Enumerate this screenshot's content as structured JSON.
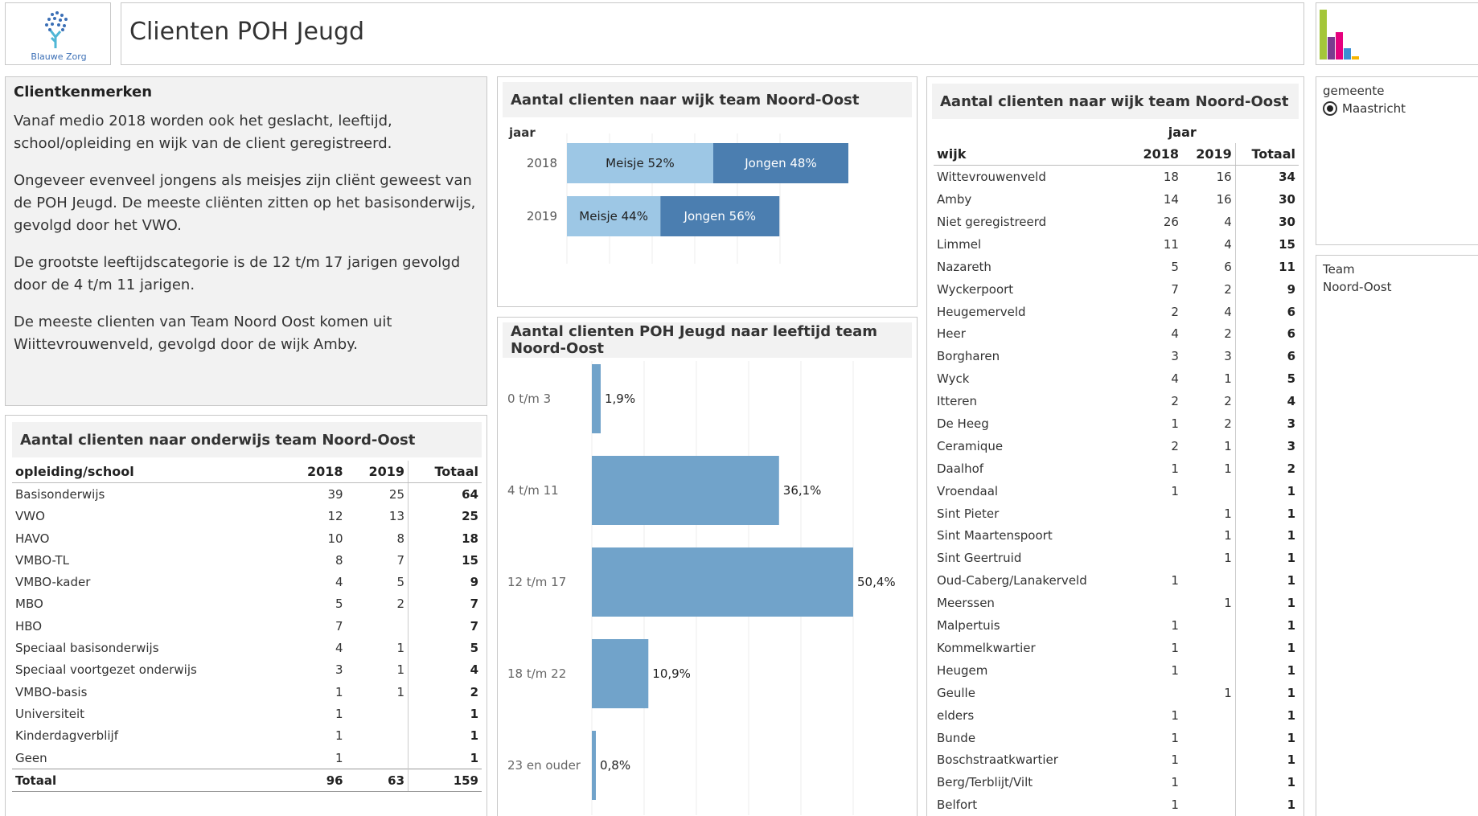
{
  "header": {
    "logo_text": "Blauwe Zorg",
    "title": "Clienten POH Jeugd"
  },
  "colors": {
    "bar_light": "#9dc7e5",
    "bar_dark": "#4b7eb0",
    "bar_age": "#71a3ca",
    "panel_bg": "#f2f2f2"
  },
  "text_panel": {
    "heading": "Clientkenmerken",
    "paragraphs": [
      "Vanaf medio 2018 worden ook het geslacht, leeftijd, school/opleiding en wijk van de client geregistreerd.",
      "Ongeveer evenveel jongens als meisjes zijn cliënt geweest van de POH Jeugd.  De meeste cliënten zitten op het basisonderwijs, gevolgd door het VWO.",
      "De grootste leeftijdscategorie is de 12 t/m 17 jarigen gevolgd door de 4 t/m 11 jarigen.",
      "De meeste clienten van Team Noord Oost komen uit Wiittevrouwenveld, gevolgd door de wijk Amby."
    ]
  },
  "onderwijs": {
    "title": "Aantal clienten naar onderwijs team Noord-Oost",
    "columns": [
      "opleiding/school",
      "2018",
      "2019",
      "Totaal"
    ],
    "rows": [
      [
        "Basisonderwijs",
        "39",
        "25",
        "64"
      ],
      [
        "VWO",
        "12",
        "13",
        "25"
      ],
      [
        "HAVO",
        "10",
        "8",
        "18"
      ],
      [
        "VMBO-TL",
        "8",
        "7",
        "15"
      ],
      [
        "VMBO-kader",
        "4",
        "5",
        "9"
      ],
      [
        "MBO",
        "5",
        "2",
        "7"
      ],
      [
        "HBO",
        "7",
        "",
        "7"
      ],
      [
        "Speciaal basisonderwijs",
        "4",
        "1",
        "5"
      ],
      [
        "Speciaal voortgezet onderwijs",
        "3",
        "1",
        "4"
      ],
      [
        "VMBO-basis",
        "1",
        "1",
        "2"
      ],
      [
        "Universiteit",
        "1",
        "",
        "1"
      ],
      [
        "Kinderdagverblijf",
        "1",
        "",
        "1"
      ],
      [
        "Geen",
        "1",
        "",
        "1"
      ]
    ],
    "total": [
      "Totaal",
      "96",
      "63",
      "159"
    ]
  },
  "geslacht": {
    "title": "Aantal clienten naar wijk team Noord-Oost",
    "axis_label": "jaar",
    "rows": [
      {
        "year": "2018",
        "meisje": 52,
        "jongen": 48,
        "meisje_label": "Meisje 52%",
        "jongen_label": "Jongen 48%"
      },
      {
        "year": "2019",
        "meisje": 44,
        "jongen": 56,
        "meisje_label": "Meisje 44%",
        "jongen_label": "Jongen 56%"
      }
    ]
  },
  "leeftijd": {
    "title": "Aantal clienten POH Jeugd naar leeftijd team Noord-Oost",
    "categories": [
      "0 t/m 3",
      "4 t/m 11",
      "12 t/m 17",
      "18 t/m 22",
      "23 en ouder"
    ],
    "values": [
      1.9,
      36.1,
      50.4,
      10.9,
      0.8
    ],
    "labels": [
      "1,9%",
      "36,1%",
      "50,4%",
      "10,9%",
      "0,8%"
    ]
  },
  "chart_data": [
    {
      "type": "bar",
      "title": "Aantal clienten naar wijk team Noord-Oost",
      "ylabel": "jaar",
      "categories": [
        "2018",
        "2019"
      ],
      "series": [
        {
          "name": "Meisje",
          "values": [
            52,
            44
          ]
        },
        {
          "name": "Jongen",
          "values": [
            48,
            56
          ]
        }
      ]
    },
    {
      "type": "bar",
      "title": "Aantal clienten POH Jeugd naar leeftijd team Noord-Oost",
      "categories": [
        "0 t/m 3",
        "4 t/m 11",
        "12 t/m 17",
        "18 t/m 22",
        "23 en ouder"
      ],
      "values": [
        1.9,
        36.1,
        50.4,
        10.9,
        0.8
      ]
    }
  ],
  "wijk": {
    "title": "Aantal clienten naar wijk team Noord-Oost",
    "group_label": "jaar",
    "columns": [
      "wijk",
      "2018",
      "2019",
      "Totaal"
    ],
    "rows": [
      [
        "Wittevrouwenveld",
        "18",
        "16",
        "34"
      ],
      [
        "Amby",
        "14",
        "16",
        "30"
      ],
      [
        "Niet geregistreerd",
        "26",
        "4",
        "30"
      ],
      [
        "Limmel",
        "11",
        "4",
        "15"
      ],
      [
        "Nazareth",
        "5",
        "6",
        "11"
      ],
      [
        "Wyckerpoort",
        "7",
        "2",
        "9"
      ],
      [
        "Heugemerveld",
        "2",
        "4",
        "6"
      ],
      [
        "Heer",
        "4",
        "2",
        "6"
      ],
      [
        "Borgharen",
        "3",
        "3",
        "6"
      ],
      [
        "Wyck",
        "4",
        "1",
        "5"
      ],
      [
        "Itteren",
        "2",
        "2",
        "4"
      ],
      [
        "De Heeg",
        "1",
        "2",
        "3"
      ],
      [
        "Ceramique",
        "2",
        "1",
        "3"
      ],
      [
        "Daalhof",
        "1",
        "1",
        "2"
      ],
      [
        "Vroendaal",
        "1",
        "",
        "1"
      ],
      [
        "Sint Pieter",
        "",
        "1",
        "1"
      ],
      [
        "Sint Maartenspoort",
        "",
        "1",
        "1"
      ],
      [
        "Sint Geertruid",
        "",
        "1",
        "1"
      ],
      [
        "Oud-Caberg/Lanakerveld",
        "1",
        "",
        "1"
      ],
      [
        "Meerssen",
        "",
        "1",
        "1"
      ],
      [
        "Malpertuis",
        "1",
        "",
        "1"
      ],
      [
        "Kommelkwartier",
        "1",
        "",
        "1"
      ],
      [
        "Heugem",
        "1",
        "",
        "1"
      ],
      [
        "Geulle",
        "",
        "1",
        "1"
      ],
      [
        "elders",
        "1",
        "",
        "1"
      ],
      [
        "Bunde",
        "1",
        "",
        "1"
      ],
      [
        "Boschstraatkwartier",
        "1",
        "",
        "1"
      ],
      [
        "Berg/Terblijt/Vilt",
        "1",
        "",
        "1"
      ],
      [
        "Belfort",
        "1",
        "",
        "1"
      ]
    ]
  },
  "filters": {
    "gemeente_label": "gemeente",
    "gemeente_value": "Maastricht",
    "team_label": "Team",
    "team_value": "Noord-Oost"
  }
}
